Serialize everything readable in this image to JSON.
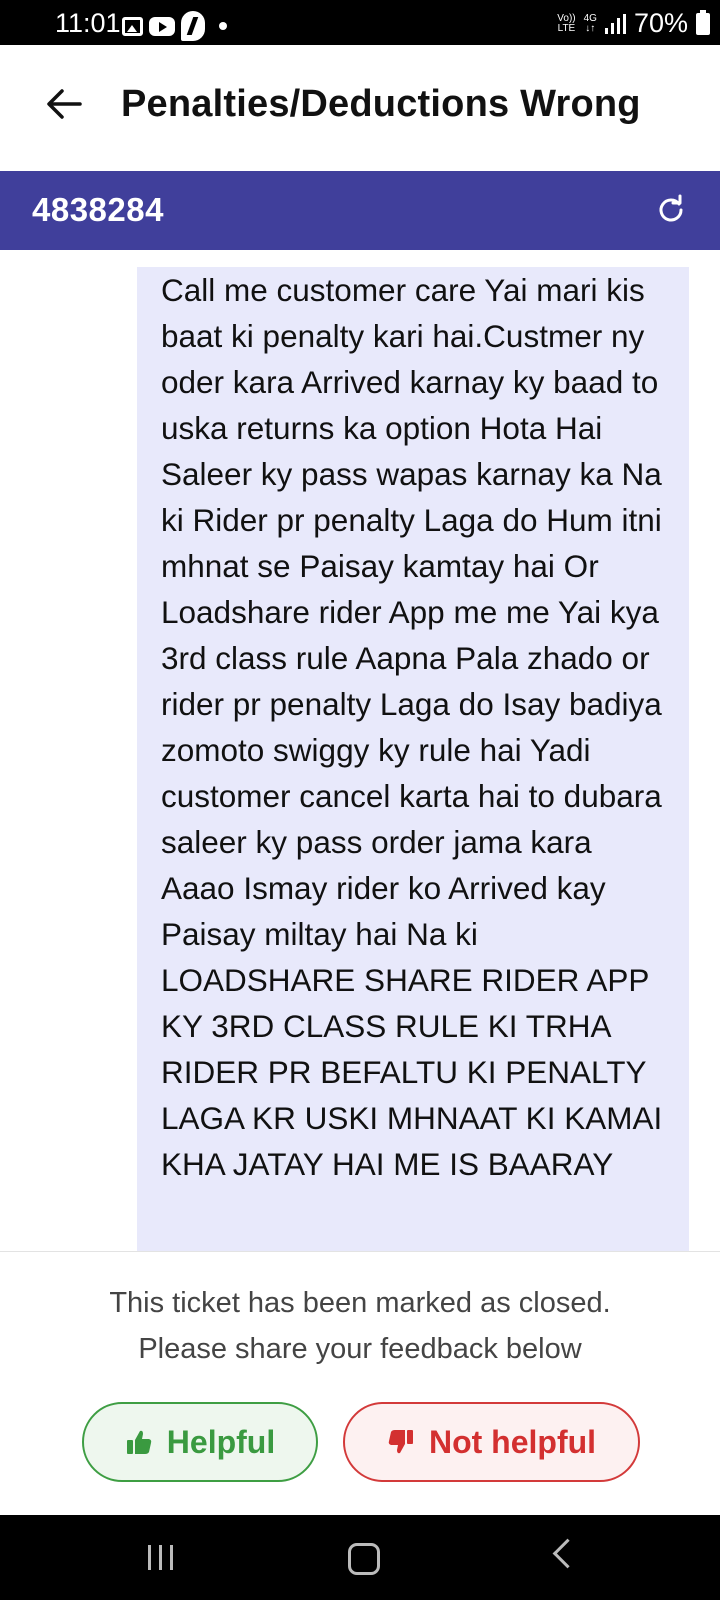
{
  "status_bar": {
    "time": "11:01",
    "network_top": "Vo))",
    "network_bottom": "LTE",
    "data_top": "4G",
    "data_bottom": "↓↑",
    "battery": "70%"
  },
  "header": {
    "title": "Penalties/Deductions Wrong"
  },
  "ticket": {
    "id": "4838284"
  },
  "message": {
    "text": "Call me customer care Yai mari kis baat ki penalty kari hai.Custmer ny oder kara Arrived karnay ky baad to uska returns ka option Hota Hai Saleer ky pass wapas karnay ka Na ki Rider pr penalty Laga do Hum itni mhnat se Paisay kamtay hai Or Loadshare rider App me me Yai kya 3rd class rule Aapna Pala zhado or rider pr penalty Laga do Isay badiya zomoto swiggy ky rule hai Yadi customer cancel karta hai to dubara saleer ky pass order jama kara Aaao Ismay rider ko Arrived kay Paisay miltay hai Na ki LOADSHARE SHARE RIDER APP KY 3RD CLASS RULE KI TRHA RIDER PR BEFALTU KI PENALTY LAGA KR USKI MHNAAT KI KAMAI KHA JATAY HAI ME IS BAARAY"
  },
  "closed_panel": {
    "line1": "This ticket has been marked as closed.",
    "line2": "Please share your feedback below",
    "helpful_label": "Helpful",
    "not_helpful_label": "Not helpful"
  },
  "colors": {
    "ticket_bar": "#403f9b",
    "bubble": "#e8e9fb",
    "helpful": "#3a9a40",
    "not_helpful": "#d33030"
  },
  "icons": {
    "back": "arrow-left-icon",
    "refresh": "refresh-icon",
    "helpful": "thumbs-up-icon",
    "not_helpful": "thumbs-down-icon"
  }
}
